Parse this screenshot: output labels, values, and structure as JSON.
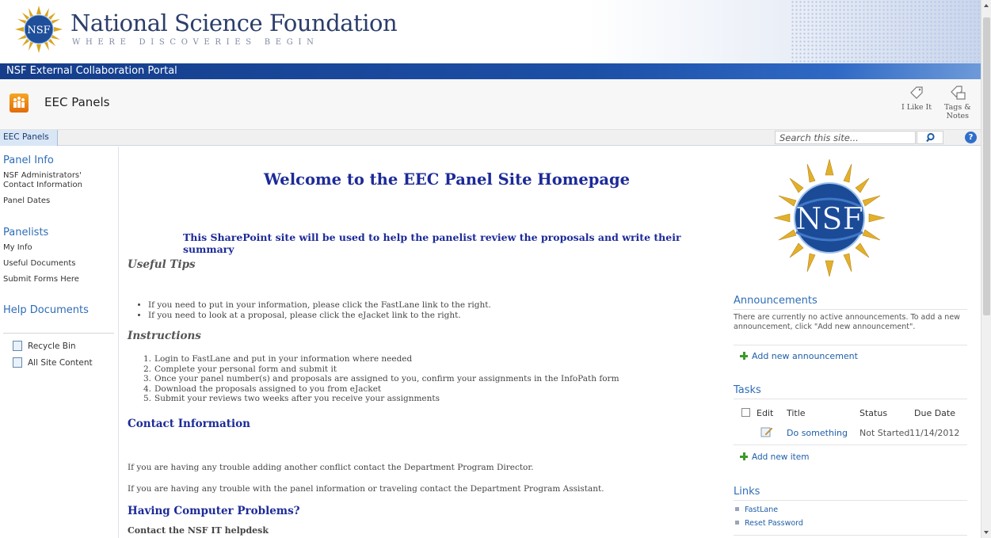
{
  "banner": {
    "org_name": "National Science Foundation",
    "tagline": "WHERE DISCOVERIES BEGIN",
    "logo_icon": "nsf-logo",
    "portal_title": "NSF External Collaboration Portal"
  },
  "site": {
    "title": "EEC Panels",
    "icon": "site-icon",
    "social": {
      "like_label": "I Like It",
      "tags_label_1": "Tags &",
      "tags_label_2": "Notes"
    }
  },
  "topnav": {
    "tab_label": "EEC Panels",
    "search_placeholder": "Search this site...",
    "search_icon": "search-icon",
    "help_icon": "help-icon",
    "help_label": "?"
  },
  "leftnav": {
    "panel_info": {
      "heading": "Panel Info",
      "items": [
        "NSF Administrators'",
        "Contact Information",
        "Panel Dates"
      ]
    },
    "panelists": {
      "heading": "Panelists",
      "items": [
        "My Info",
        "Useful Documents",
        "Submit Forms Here"
      ]
    },
    "help_documents": "Help Documents",
    "recycle_bin": "Recycle Bin",
    "all_site_content": "All Site Content"
  },
  "main": {
    "welcome": "Welcome to the EEC Panel Site Homepage",
    "subtitle": "This SharePoint site will be used to help the panelist review the proposals and write their summary",
    "useful_tips_heading": "Useful Tips",
    "tips": [
      "If you need to put in your information, please click the FastLane link to the right.",
      "If you need to look at a proposal, please click the eJacket link to the right."
    ],
    "instructions_heading": "Instructions",
    "instructions": [
      "Login to FastLane and put in your information where needed",
      "Complete your personal form and submit it",
      "Once your panel number(s) and proposals are assigned to you, confirm your assignments in the InfoPath form",
      "Download the proposals assigned to you from eJacket",
      "Submit your reviews two weeks after you receive your assignments"
    ],
    "contact_heading": "Contact Information",
    "contact_para_1": "If you are having any trouble adding another conflict contact the Department Program Director.",
    "contact_para_2": "If you are having any trouble with the panel information or traveling contact the Department Program Assistant.",
    "computer_heading": "Having Computer Problems?",
    "helpdesk": "Contact the NSF IT helpdesk"
  },
  "announcements": {
    "title": "Announcements",
    "empty_text_1": "There are currently no active announcements. To add a new",
    "empty_text_2": "announcement, click \"Add new announcement\".",
    "add_label": "Add new announcement"
  },
  "tasks": {
    "title": "Tasks",
    "columns": [
      "Edit",
      "Title",
      "Status",
      "Due Date"
    ],
    "rows": [
      {
        "title": "Do something",
        "status": "Not Started",
        "due": "11/14/2012"
      }
    ],
    "add_label": "Add new item"
  },
  "links": {
    "title": "Links",
    "items": [
      "FastLane",
      "Reset Password"
    ]
  },
  "colors": {
    "accent_blue": "#2e6db7",
    "heading_navy": "#1c2a98",
    "portal_bar": "#1c4fa6"
  }
}
